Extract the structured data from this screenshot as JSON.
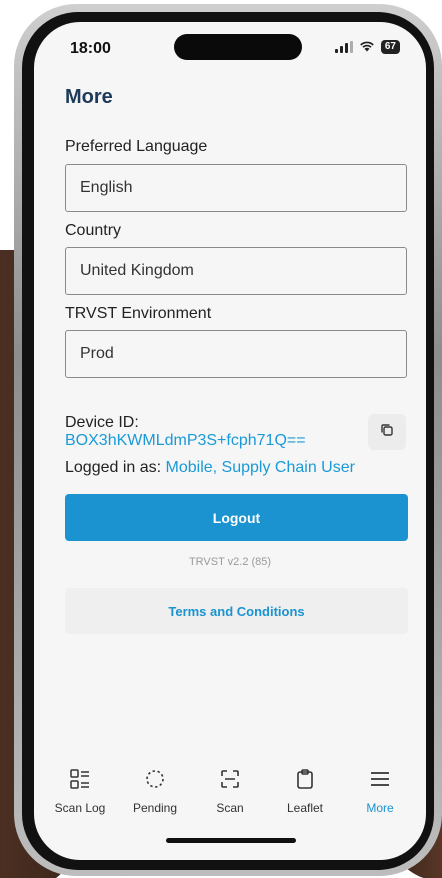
{
  "status": {
    "time": "18:00",
    "battery": "67"
  },
  "header": {
    "title": "More"
  },
  "form": {
    "language_label": "Preferred Language",
    "language_value": "English",
    "country_label": "Country",
    "country_value": "United Kingdom",
    "environment_label": "TRVST Environment",
    "environment_value": "Prod"
  },
  "device": {
    "id_label": "Device ID:",
    "id_value": "BOX3hKWMLdmP3S+fcph71Q==",
    "logged_label": "Logged in as:",
    "logged_user": "Mobile, Supply Chain User"
  },
  "actions": {
    "logout_label": "Logout",
    "version": "TRVST v2.2 (85)",
    "terms_label": "Terms and Conditions"
  },
  "tabs": [
    {
      "label": "Scan Log",
      "icon": "scan-log-icon"
    },
    {
      "label": "Pending",
      "icon": "pending-icon"
    },
    {
      "label": "Scan",
      "icon": "scan-icon"
    },
    {
      "label": "Leaflet",
      "icon": "clipboard-icon"
    },
    {
      "label": "More",
      "icon": "menu-icon",
      "active": true
    }
  ],
  "colors": {
    "accent": "#1a93d0",
    "title": "#1e3a5a",
    "link": "#1a9ad6"
  }
}
